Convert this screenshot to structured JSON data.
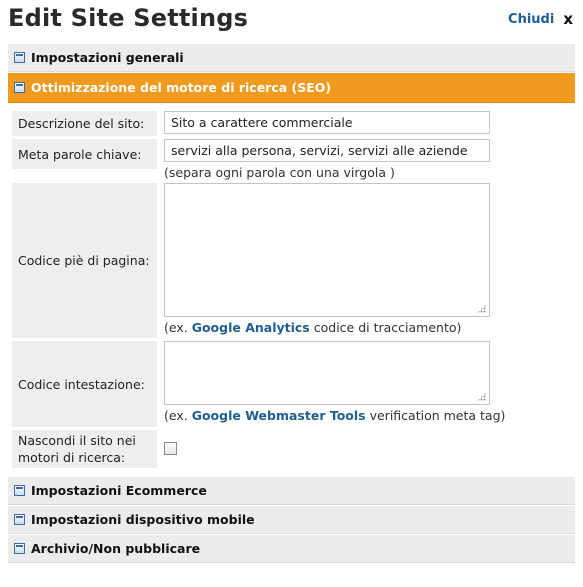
{
  "header": {
    "title": "Edit Site Settings",
    "close_label": "Chiudi",
    "close_symbol": "x"
  },
  "sections": {
    "general": "Impostazioni generali",
    "seo": "Ottimizzazione del motore di ricerca (SEO)",
    "ecommerce": "Impostazioni Ecommerce",
    "mobile": "Impostazioni dispositivo mobile",
    "archive": "Archivio/Non pubblicare"
  },
  "seo_form": {
    "description_label": "Descrizione del sito:",
    "description_value": "Sito a carattere commerciale",
    "keywords_label": "Meta parole chiave:",
    "keywords_value": "servizi alla persona, servizi, servizi alle aziende",
    "keywords_hint": "(separa ogni parola con una virgola )",
    "footer_code_label": "Codice piè di pagina:",
    "footer_hint_prefix": "(ex.",
    "footer_hint_link": "Google Analytics",
    "footer_hint_suffix": "codice di tracciamento)",
    "header_code_label": "Codice intestazione:",
    "header_hint_prefix": "(ex.",
    "header_hint_link": "Google Webmaster Tools",
    "header_hint_suffix": "verification meta tag)",
    "hide_label": "Nascondi il sito nei motori di ricerca:",
    "hide_checked": false
  },
  "colors": {
    "accent_orange": "#f29a1d",
    "link_blue": "#1f5e96",
    "section_gray": "#ececec"
  }
}
